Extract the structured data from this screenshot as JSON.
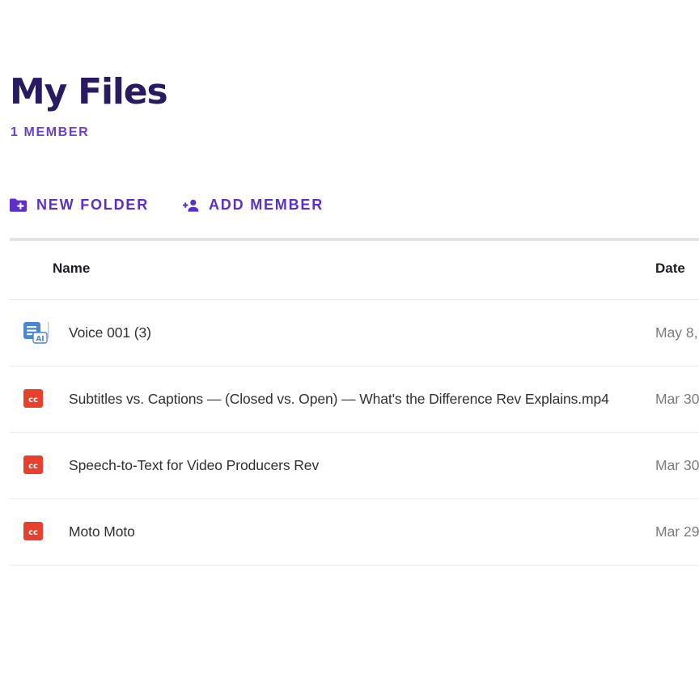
{
  "page": {
    "title": "My Files",
    "member_count": "1 MEMBER"
  },
  "actions": {
    "new_folder": "NEW FOLDER",
    "add_member": "ADD MEMBER"
  },
  "table": {
    "columns": {
      "name": "Name",
      "date": "Date"
    },
    "rows": [
      {
        "name": "Voice 001 (3)",
        "date": "May 8,",
        "type": "ai-transcript-icon"
      },
      {
        "name": "Subtitles vs. Captions — (Closed vs. Open) — What's the Difference Rev Explains.mp4",
        "date": "Mar 30",
        "type": "cc-icon"
      },
      {
        "name": "Speech-to-Text for Video Producers Rev",
        "date": "Mar 30",
        "type": "cc-icon"
      },
      {
        "name": "Moto Moto",
        "date": "Mar 29",
        "type": "cc-icon"
      }
    ]
  },
  "colors": {
    "title": "#2a1a62",
    "accent": "#5b2fc9",
    "cc_red": "#e8402f",
    "ai_blue": "#4a86d8"
  }
}
